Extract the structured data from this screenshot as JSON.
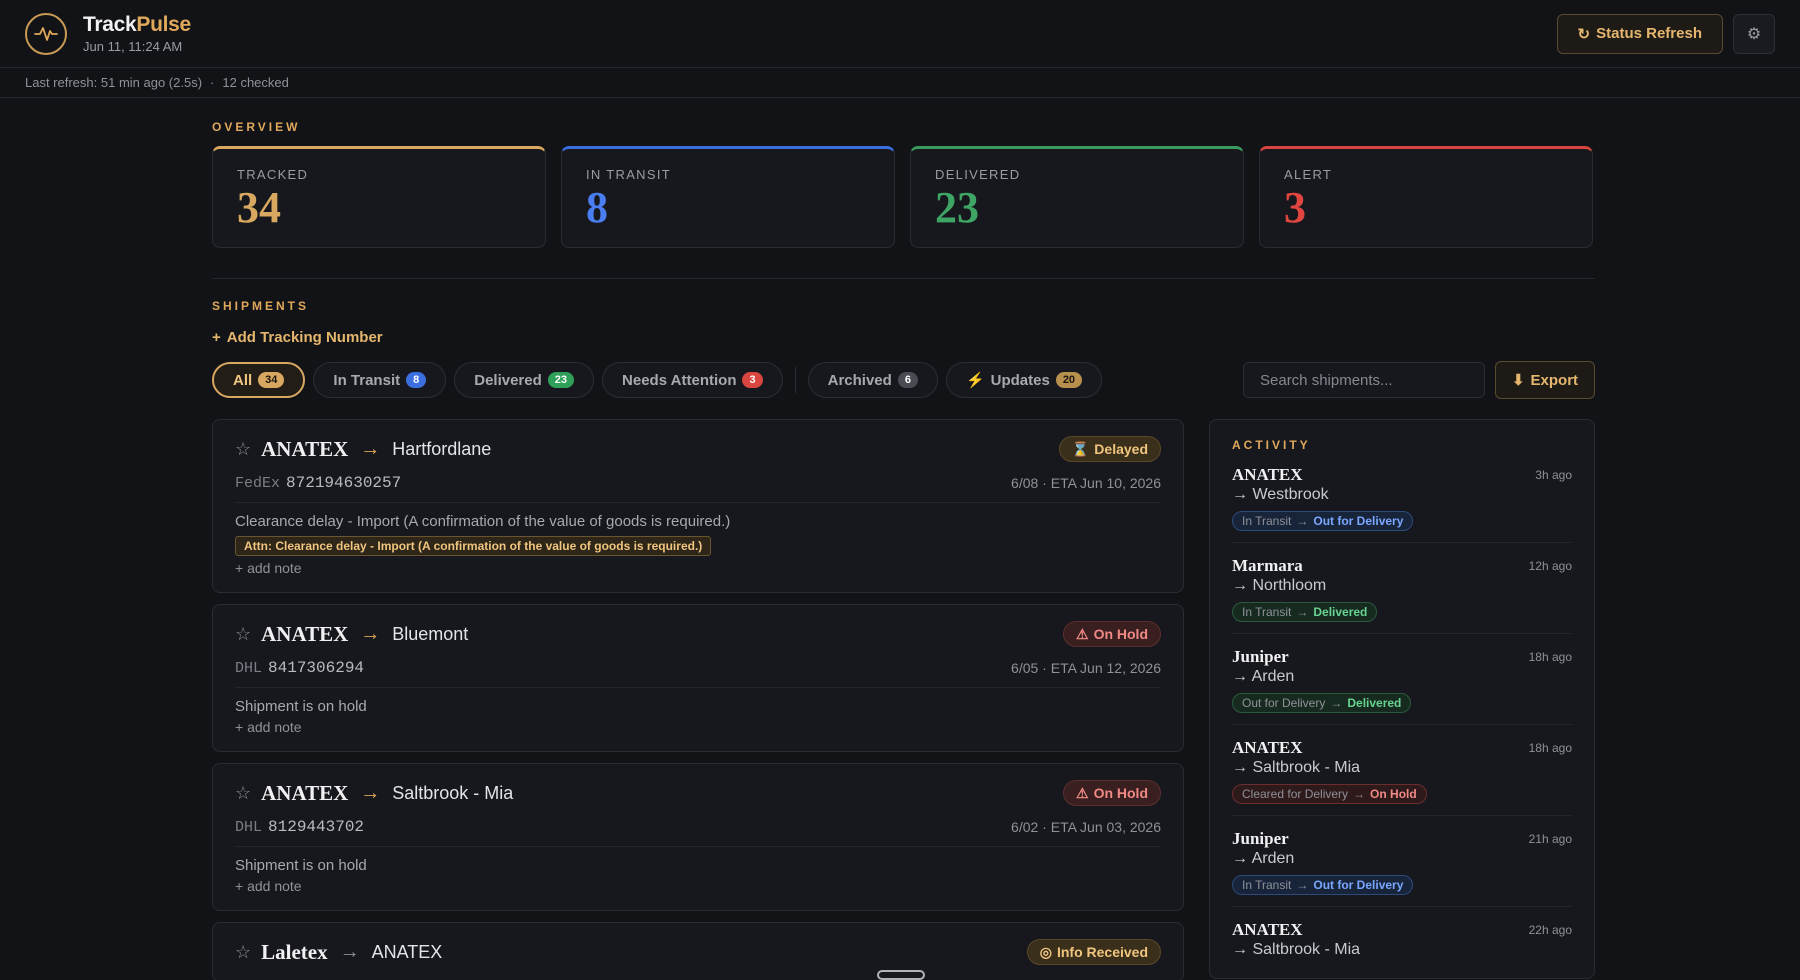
{
  "header": {
    "brand_first": "Track",
    "brand_second": "Pulse",
    "date": "Jun 11, 11:24 AM",
    "refresh_label": "Status Refresh",
    "settings_icon": "gear-icon"
  },
  "subbar": {
    "last_refresh": "Last refresh: 51 min ago (2.5s)",
    "sep": "·",
    "checked": "12 checked"
  },
  "overview": {
    "label": "OVERVIEW",
    "stats": [
      {
        "label": "TRACKED",
        "value": "34",
        "color": "#d9a860"
      },
      {
        "label": "IN TRANSIT",
        "value": "8",
        "color": "#3b6fe0"
      },
      {
        "label": "DELIVERED",
        "value": "23",
        "color": "#3a9a5e"
      },
      {
        "label": "ALERT",
        "value": "3",
        "color": "#d9453f"
      }
    ]
  },
  "shipments": {
    "label": "SHIPMENTS",
    "add_label": "Add Tracking Number",
    "filters": [
      {
        "label": "All",
        "count": "34",
        "color": "#d9a860"
      },
      {
        "label": "In Transit",
        "count": "8",
        "color": "#3b6fe0"
      },
      {
        "label": "Delivered",
        "count": "23",
        "color": "#2fa05a"
      },
      {
        "label": "Needs Attention",
        "count": "3",
        "color": "#d9453f"
      },
      {
        "label": "Archived",
        "count": "6",
        "color": "#4a4c54"
      },
      {
        "label": "Updates",
        "count": "20",
        "color": "#b8904e"
      }
    ],
    "search_placeholder": "Search shipments...",
    "export_label": "Export",
    "cards": [
      {
        "from": "ANATEX",
        "to": "Hartfordlane",
        "status": "Delayed",
        "carrier": "FedEx",
        "tracking": "872194630257",
        "eta": "6/08 · ETA Jun 10, 2026",
        "desc": "Clearance delay - Import (A confirmation of the value of goods is required.)",
        "attn": "Attn: Clearance delay - Import (A confirmation of the value of goods is required.)",
        "note": "+ add note"
      },
      {
        "from": "ANATEX",
        "to": "Bluemont",
        "status": "On Hold",
        "carrier": "DHL",
        "tracking": "8417306294",
        "eta": "6/05 · ETA Jun 12, 2026",
        "desc": "Shipment is on hold",
        "note": "+ add note"
      },
      {
        "from": "ANATEX",
        "to": "Saltbrook - Mia",
        "status": "On Hold",
        "carrier": "DHL",
        "tracking": "8129443702",
        "eta": "6/02 · ETA Jun 03, 2026",
        "desc": "Shipment is on hold",
        "note": "+ add note"
      },
      {
        "from": "Laletex",
        "to": "ANATEX",
        "status": "Info Received"
      }
    ]
  },
  "activity": {
    "label": "ACTIVITY",
    "items": [
      {
        "from": "ANATEX",
        "to": "→ Westbrook",
        "time": "3h ago",
        "old": "In Transit",
        "new": "Out for Delivery"
      },
      {
        "from": "Marmara",
        "to": "→ Northloom",
        "time": "12h ago",
        "old": "In Transit",
        "new": "Delivered"
      },
      {
        "from": "Juniper",
        "to": "→ Arden",
        "time": "18h ago",
        "old": "Out for Delivery",
        "new": "Delivered"
      },
      {
        "from": "ANATEX",
        "to": "→ Saltbrook - Mia",
        "time": "18h ago",
        "old": "Cleared for Delivery",
        "new": "On Hold"
      },
      {
        "from": "Juniper",
        "to": "→ Arden",
        "time": "21h ago",
        "old": "In Transit",
        "new": "Out for Delivery"
      },
      {
        "from": "ANATEX",
        "to": "→ Saltbrook - Mia",
        "time": "22h ago"
      }
    ]
  }
}
